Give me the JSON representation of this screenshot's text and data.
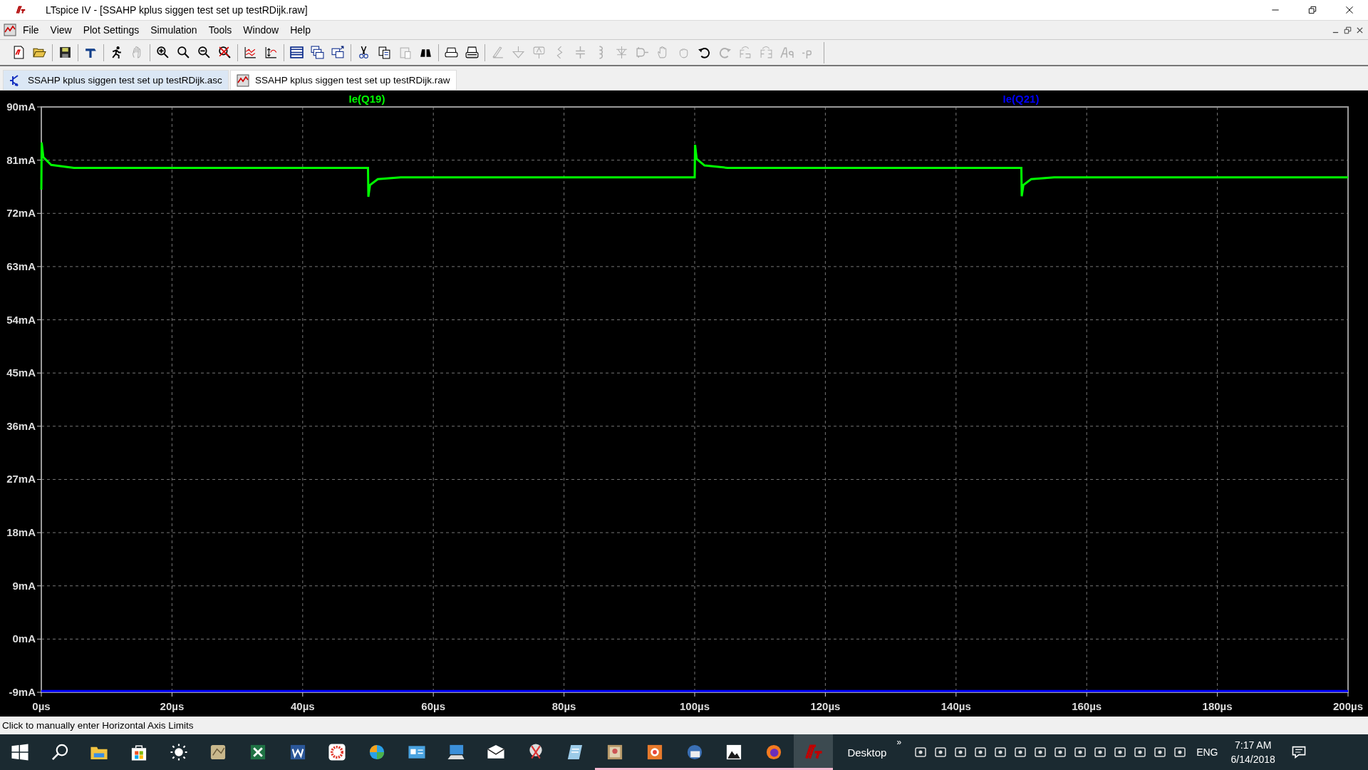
{
  "window": {
    "title": "LTspice IV - [SSAHP kplus siggen test set up testRDijk.raw]"
  },
  "menu": [
    "File",
    "View",
    "Plot Settings",
    "Simulation",
    "Tools",
    "Window",
    "Help"
  ],
  "toolbar": [
    {
      "disabled": false
    },
    {
      "disabled": false
    },
    {
      "disabled": false
    },
    {
      "disabled": false
    },
    {
      "disabled": false
    },
    {
      "disabled": true
    },
    {
      "disabled": false
    },
    {
      "disabled": false
    },
    {
      "disabled": false
    },
    {
      "disabled": false
    },
    {
      "disabled": false
    },
    {
      "disabled": false
    },
    {
      "disabled": false
    },
    {
      "disabled": false
    },
    {
      "disabled": false
    },
    {
      "disabled": false
    },
    {
      "disabled": false
    },
    {
      "disabled": true
    },
    {
      "disabled": false
    },
    {
      "disabled": false
    },
    {
      "disabled": false
    },
    {
      "disabled": true
    },
    {
      "disabled": true
    },
    {
      "disabled": true
    },
    {
      "disabled": true
    },
    {
      "disabled": true
    },
    {
      "disabled": true
    },
    {
      "disabled": true
    },
    {
      "disabled": true
    },
    {
      "disabled": true
    },
    {
      "disabled": true
    },
    {
      "disabled": false
    },
    {
      "disabled": true
    },
    {
      "disabled": true
    },
    {
      "disabled": true
    },
    {
      "disabled": true
    },
    {
      "disabled": true
    }
  ],
  "tabs": [
    {
      "label": "SSAHP kplus siggen test set up testRDijk.asc",
      "kind": "schematic",
      "selected": false
    },
    {
      "label": "SSAHP kplus siggen test set up testRDijk.raw",
      "kind": "waveform",
      "selected": true
    }
  ],
  "plot": {
    "chart_data": {
      "type": "line",
      "x": [
        0,
        0.05,
        0.3,
        1.5,
        5,
        50,
        50.05,
        50.3,
        51.5,
        55,
        100,
        100.05,
        100.3,
        101.5,
        105,
        150,
        150.05,
        150.3,
        151.5,
        155,
        200
      ],
      "series": [
        {
          "name": "Ie(Q19)",
          "color": "#00ff00",
          "values": [
            76,
            84,
            81.5,
            80.2,
            79.7,
            79.7,
            74.8,
            76.8,
            77.8,
            78.1,
            78.1,
            83.6,
            81.2,
            80.1,
            79.7,
            79.7,
            74.9,
            76.8,
            77.8,
            78.1,
            78.1
          ]
        },
        {
          "name": "Ie(Q21)",
          "color": "#0000ff",
          "values": [
            -8.8,
            -8.8,
            -8.8,
            -8.8,
            -8.8,
            -8.8,
            -8.8,
            -8.8,
            -8.8,
            -8.8,
            -8.8,
            -8.8,
            -8.8,
            -8.8,
            -8.8,
            -8.8,
            -8.8,
            -8.8,
            -8.8,
            -8.8,
            -8.8
          ]
        }
      ],
      "grid": true,
      "xlim": [
        0,
        200
      ],
      "ylim": [
        -9,
        90
      ],
      "xticks": [
        {
          "value": 0,
          "label": "0µs"
        },
        {
          "value": 20,
          "label": "20µs"
        },
        {
          "value": 40,
          "label": "40µs"
        },
        {
          "value": 60,
          "label": "60µs"
        },
        {
          "value": 80,
          "label": "80µs"
        },
        {
          "value": 100,
          "label": "100µs"
        },
        {
          "value": 120,
          "label": "120µs"
        },
        {
          "value": 140,
          "label": "140µs"
        },
        {
          "value": 160,
          "label": "160µs"
        },
        {
          "value": 180,
          "label": "180µs"
        },
        {
          "value": 200,
          "label": "200µs"
        }
      ],
      "yticks": [
        {
          "value": -9,
          "label": "-9mA"
        },
        {
          "value": 0,
          "label": "0mA"
        },
        {
          "value": 9,
          "label": "9mA"
        },
        {
          "value": 18,
          "label": "18mA"
        },
        {
          "value": 27,
          "label": "27mA"
        },
        {
          "value": 36,
          "label": "36mA"
        },
        {
          "value": 45,
          "label": "45mA"
        },
        {
          "value": 54,
          "label": "54mA"
        },
        {
          "value": 63,
          "label": "63mA"
        },
        {
          "value": 72,
          "label": "72mA"
        },
        {
          "value": 81,
          "label": "81mA"
        },
        {
          "value": 90,
          "label": "90mA"
        }
      ]
    }
  },
  "status_bar": "Click to manually enter Horizontal Axis Limits",
  "taskbar": {
    "apps": [
      {
        "running": false
      },
      {
        "running": false
      },
      {
        "running": false
      },
      {
        "running": false
      },
      {
        "running": false
      },
      {
        "running": false
      },
      {
        "running": false
      },
      {
        "running": false
      },
      {
        "running": false
      },
      {
        "running": false
      },
      {
        "running": false
      },
      {
        "running": false
      },
      {
        "running": false
      },
      {
        "running": false
      },
      {
        "running": false
      },
      {
        "running": true
      },
      {
        "running": true
      },
      {
        "running": true
      },
      {
        "running": true
      },
      {
        "running": true
      },
      {
        "running": true,
        "selected": true
      }
    ],
    "desktop": "Desktop",
    "chevron": "»",
    "language": "ENG",
    "time": "7:17 AM",
    "date": "6/14/2018"
  }
}
